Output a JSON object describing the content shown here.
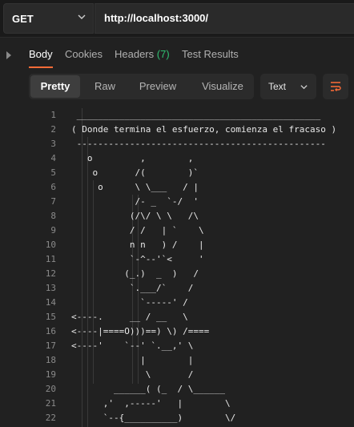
{
  "request": {
    "method": "GET",
    "url": "http://localhost:3000/"
  },
  "response_tabs": [
    {
      "label": "Body",
      "active": true
    },
    {
      "label": "Cookies"
    },
    {
      "label": "Headers",
      "count": "(7)"
    },
    {
      "label": "Test Results"
    }
  ],
  "view_modes": [
    "Pretty",
    "Raw",
    "Preview",
    "Visualize"
  ],
  "active_view": "Pretty",
  "format": "Text",
  "icons": {
    "method_dropdown": "chevron-down-icon",
    "collapse": "chevron-right-icon",
    "format_dropdown": "chevron-down-icon",
    "wrap": "wrap-lines-icon"
  },
  "colors": {
    "accent": "#ff6c37",
    "headers_count": "#2fbf71",
    "wrap_icon": "#ff6c37"
  },
  "body_lines": [
    {
      "n": "1",
      "text": " ______________________________________________"
    },
    {
      "n": "2",
      "text": "( Donde termina el esfuerzo, comienza el fracaso )"
    },
    {
      "n": "3",
      "text": " -----------------------------------------------"
    },
    {
      "n": "4",
      "text": "   o         ,        ,"
    },
    {
      "n": "5",
      "text": "    o       /(        )`"
    },
    {
      "n": "6",
      "text": "     o      \\ \\___   / |"
    },
    {
      "n": "7",
      "text": "            /- _  `-/  '"
    },
    {
      "n": "8",
      "text": "           (/\\/ \\ \\   /\\"
    },
    {
      "n": "9",
      "text": "           / /   | `    \\"
    },
    {
      "n": "10",
      "text": "           n n   ) /    |"
    },
    {
      "n": "11",
      "text": "           `-^--'`<     '"
    },
    {
      "n": "12",
      "text": "          (_.)  _  )   /"
    },
    {
      "n": "13",
      "text": "           `.___/`    /"
    },
    {
      "n": "14",
      "text": "             `-----' /"
    },
    {
      "n": "15",
      "text": "<----.     __ / __   \\"
    },
    {
      "n": "16",
      "text": "<----|====O)))==) \\) /===="
    },
    {
      "n": "17",
      "text": "<----'    `--' `.__,' \\"
    },
    {
      "n": "18",
      "text": "             |        |"
    },
    {
      "n": "19",
      "text": "              \\       /"
    },
    {
      "n": "20",
      "text": "        ______( (_  / \\______"
    },
    {
      "n": "21",
      "text": "      ,'  ,-----'   |        \\"
    },
    {
      "n": "22",
      "text": "      `--{__________)        \\/"
    }
  ]
}
